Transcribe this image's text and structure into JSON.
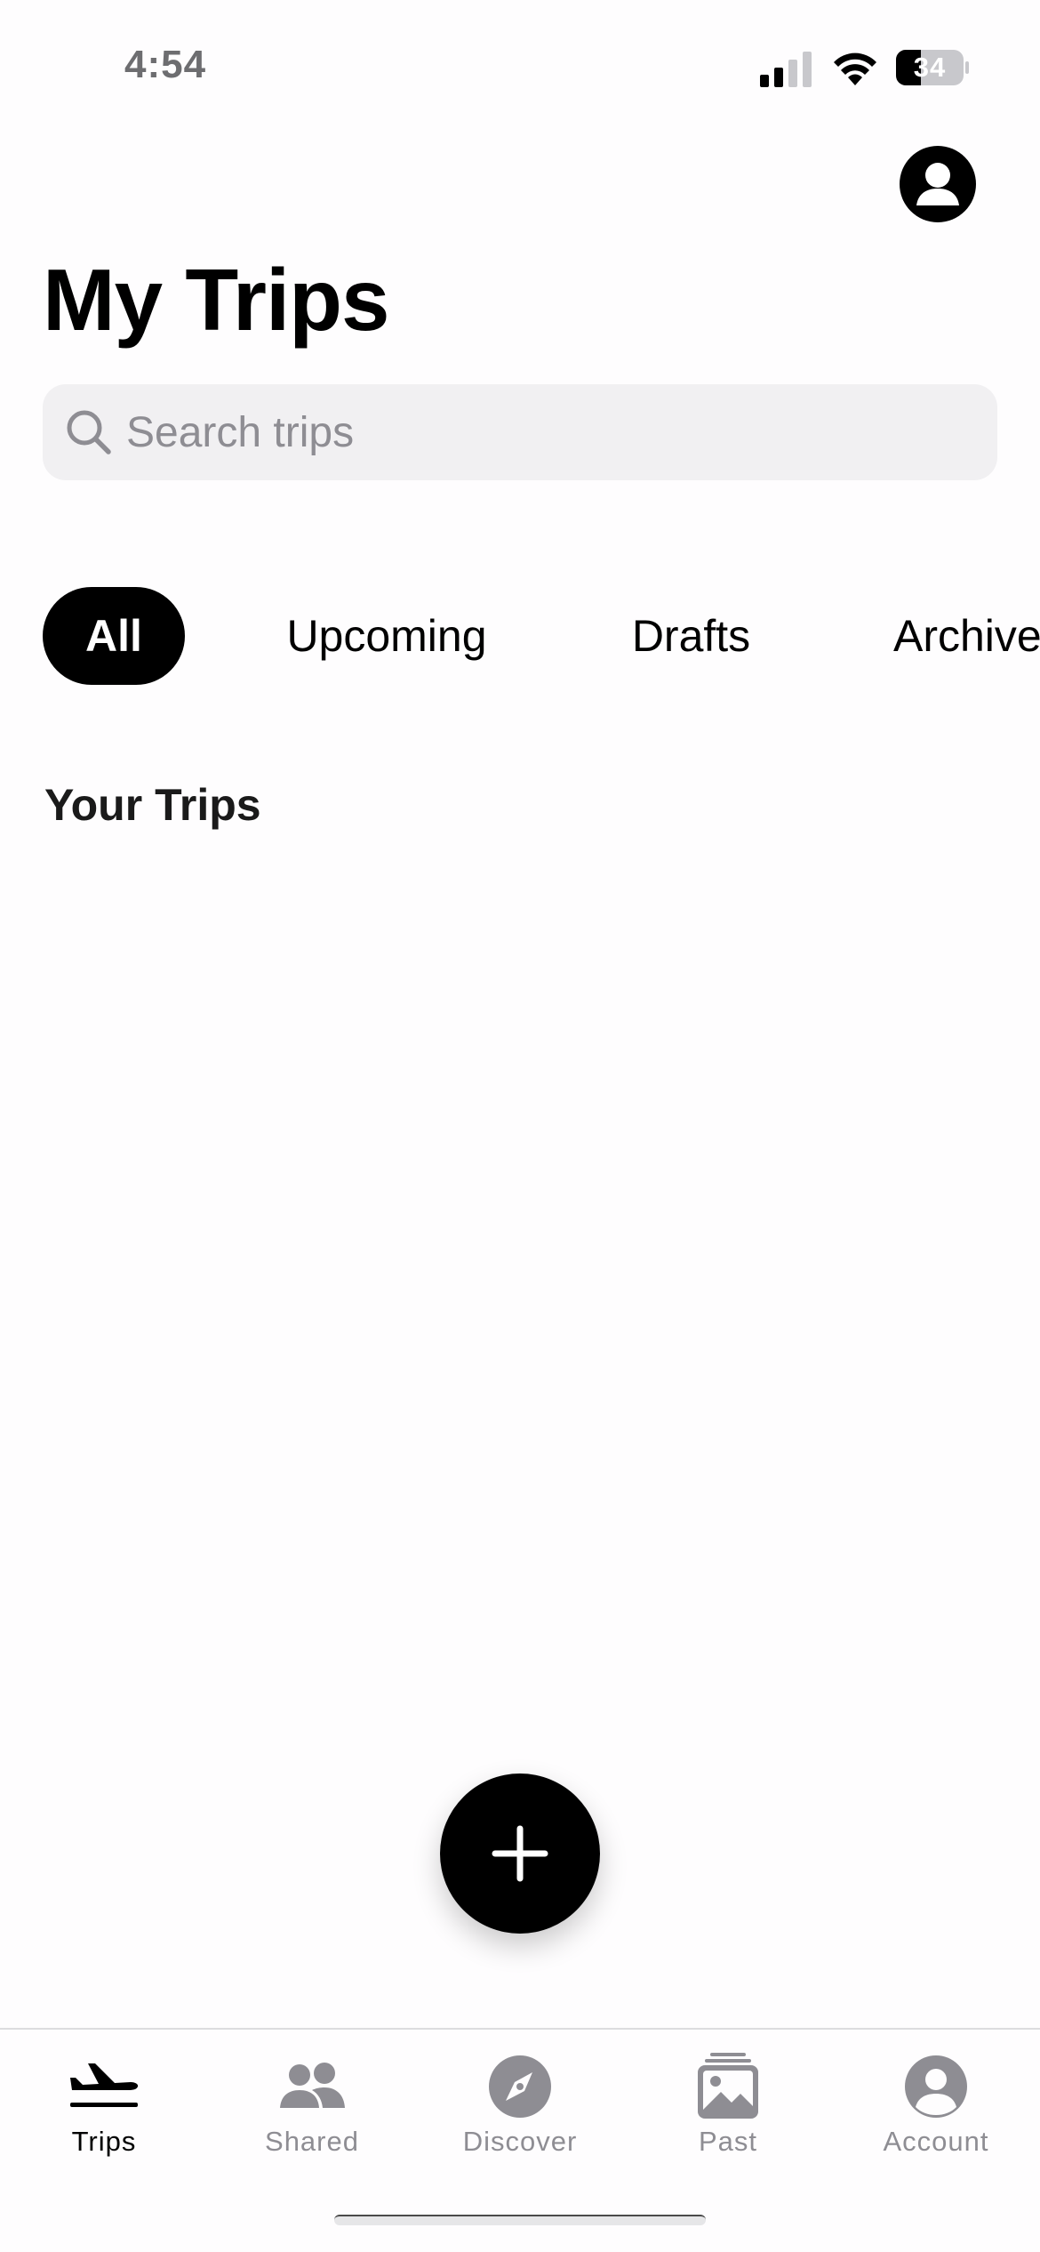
{
  "status": {
    "time": "4:54",
    "battery": "34"
  },
  "header": {
    "title": "My Trips",
    "profile_icon": "person-circle-icon"
  },
  "search": {
    "placeholder": "Search trips",
    "value": ""
  },
  "filters": [
    {
      "label": "All",
      "active": true
    },
    {
      "label": "Upcoming",
      "active": false
    },
    {
      "label": "Drafts",
      "active": false
    },
    {
      "label": "Archive",
      "active": false
    }
  ],
  "section": {
    "title": "Your Trips"
  },
  "fab": {
    "icon": "plus-icon"
  },
  "tab_bar": {
    "items": [
      {
        "label": "Trips",
        "icon": "airplane-icon",
        "active": true
      },
      {
        "label": "Shared",
        "icon": "people-icon",
        "active": false
      },
      {
        "label": "Discover",
        "icon": "compass-icon",
        "active": false
      },
      {
        "label": "Past",
        "icon": "photo-stack-icon",
        "active": false
      },
      {
        "label": "Account",
        "icon": "account-icon",
        "active": false
      }
    ]
  },
  "colors": {
    "accent": "#000000",
    "inactive": "#8e8d93",
    "search_bg": "#f1f0f2",
    "background": "#fefdfe"
  }
}
